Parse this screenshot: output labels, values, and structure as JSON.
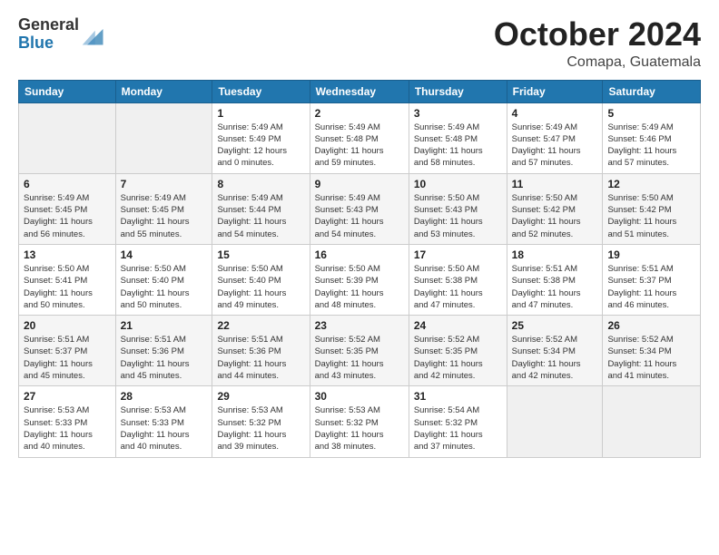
{
  "header": {
    "logo_general": "General",
    "logo_blue": "Blue",
    "month_title": "October 2024",
    "location": "Comapa, Guatemala"
  },
  "weekdays": [
    "Sunday",
    "Monday",
    "Tuesday",
    "Wednesday",
    "Thursday",
    "Friday",
    "Saturday"
  ],
  "weeks": [
    [
      {
        "day": "",
        "info": ""
      },
      {
        "day": "",
        "info": ""
      },
      {
        "day": "1",
        "info": "Sunrise: 5:49 AM\nSunset: 5:49 PM\nDaylight: 12 hours\nand 0 minutes."
      },
      {
        "day": "2",
        "info": "Sunrise: 5:49 AM\nSunset: 5:48 PM\nDaylight: 11 hours\nand 59 minutes."
      },
      {
        "day": "3",
        "info": "Sunrise: 5:49 AM\nSunset: 5:48 PM\nDaylight: 11 hours\nand 58 minutes."
      },
      {
        "day": "4",
        "info": "Sunrise: 5:49 AM\nSunset: 5:47 PM\nDaylight: 11 hours\nand 57 minutes."
      },
      {
        "day": "5",
        "info": "Sunrise: 5:49 AM\nSunset: 5:46 PM\nDaylight: 11 hours\nand 57 minutes."
      }
    ],
    [
      {
        "day": "6",
        "info": "Sunrise: 5:49 AM\nSunset: 5:45 PM\nDaylight: 11 hours\nand 56 minutes."
      },
      {
        "day": "7",
        "info": "Sunrise: 5:49 AM\nSunset: 5:45 PM\nDaylight: 11 hours\nand 55 minutes."
      },
      {
        "day": "8",
        "info": "Sunrise: 5:49 AM\nSunset: 5:44 PM\nDaylight: 11 hours\nand 54 minutes."
      },
      {
        "day": "9",
        "info": "Sunrise: 5:49 AM\nSunset: 5:43 PM\nDaylight: 11 hours\nand 54 minutes."
      },
      {
        "day": "10",
        "info": "Sunrise: 5:50 AM\nSunset: 5:43 PM\nDaylight: 11 hours\nand 53 minutes."
      },
      {
        "day": "11",
        "info": "Sunrise: 5:50 AM\nSunset: 5:42 PM\nDaylight: 11 hours\nand 52 minutes."
      },
      {
        "day": "12",
        "info": "Sunrise: 5:50 AM\nSunset: 5:42 PM\nDaylight: 11 hours\nand 51 minutes."
      }
    ],
    [
      {
        "day": "13",
        "info": "Sunrise: 5:50 AM\nSunset: 5:41 PM\nDaylight: 11 hours\nand 50 minutes."
      },
      {
        "day": "14",
        "info": "Sunrise: 5:50 AM\nSunset: 5:40 PM\nDaylight: 11 hours\nand 50 minutes."
      },
      {
        "day": "15",
        "info": "Sunrise: 5:50 AM\nSunset: 5:40 PM\nDaylight: 11 hours\nand 49 minutes."
      },
      {
        "day": "16",
        "info": "Sunrise: 5:50 AM\nSunset: 5:39 PM\nDaylight: 11 hours\nand 48 minutes."
      },
      {
        "day": "17",
        "info": "Sunrise: 5:50 AM\nSunset: 5:38 PM\nDaylight: 11 hours\nand 47 minutes."
      },
      {
        "day": "18",
        "info": "Sunrise: 5:51 AM\nSunset: 5:38 PM\nDaylight: 11 hours\nand 47 minutes."
      },
      {
        "day": "19",
        "info": "Sunrise: 5:51 AM\nSunset: 5:37 PM\nDaylight: 11 hours\nand 46 minutes."
      }
    ],
    [
      {
        "day": "20",
        "info": "Sunrise: 5:51 AM\nSunset: 5:37 PM\nDaylight: 11 hours\nand 45 minutes."
      },
      {
        "day": "21",
        "info": "Sunrise: 5:51 AM\nSunset: 5:36 PM\nDaylight: 11 hours\nand 45 minutes."
      },
      {
        "day": "22",
        "info": "Sunrise: 5:51 AM\nSunset: 5:36 PM\nDaylight: 11 hours\nand 44 minutes."
      },
      {
        "day": "23",
        "info": "Sunrise: 5:52 AM\nSunset: 5:35 PM\nDaylight: 11 hours\nand 43 minutes."
      },
      {
        "day": "24",
        "info": "Sunrise: 5:52 AM\nSunset: 5:35 PM\nDaylight: 11 hours\nand 42 minutes."
      },
      {
        "day": "25",
        "info": "Sunrise: 5:52 AM\nSunset: 5:34 PM\nDaylight: 11 hours\nand 42 minutes."
      },
      {
        "day": "26",
        "info": "Sunrise: 5:52 AM\nSunset: 5:34 PM\nDaylight: 11 hours\nand 41 minutes."
      }
    ],
    [
      {
        "day": "27",
        "info": "Sunrise: 5:53 AM\nSunset: 5:33 PM\nDaylight: 11 hours\nand 40 minutes."
      },
      {
        "day": "28",
        "info": "Sunrise: 5:53 AM\nSunset: 5:33 PM\nDaylight: 11 hours\nand 40 minutes."
      },
      {
        "day": "29",
        "info": "Sunrise: 5:53 AM\nSunset: 5:32 PM\nDaylight: 11 hours\nand 39 minutes."
      },
      {
        "day": "30",
        "info": "Sunrise: 5:53 AM\nSunset: 5:32 PM\nDaylight: 11 hours\nand 38 minutes."
      },
      {
        "day": "31",
        "info": "Sunrise: 5:54 AM\nSunset: 5:32 PM\nDaylight: 11 hours\nand 37 minutes."
      },
      {
        "day": "",
        "info": ""
      },
      {
        "day": "",
        "info": ""
      }
    ]
  ]
}
